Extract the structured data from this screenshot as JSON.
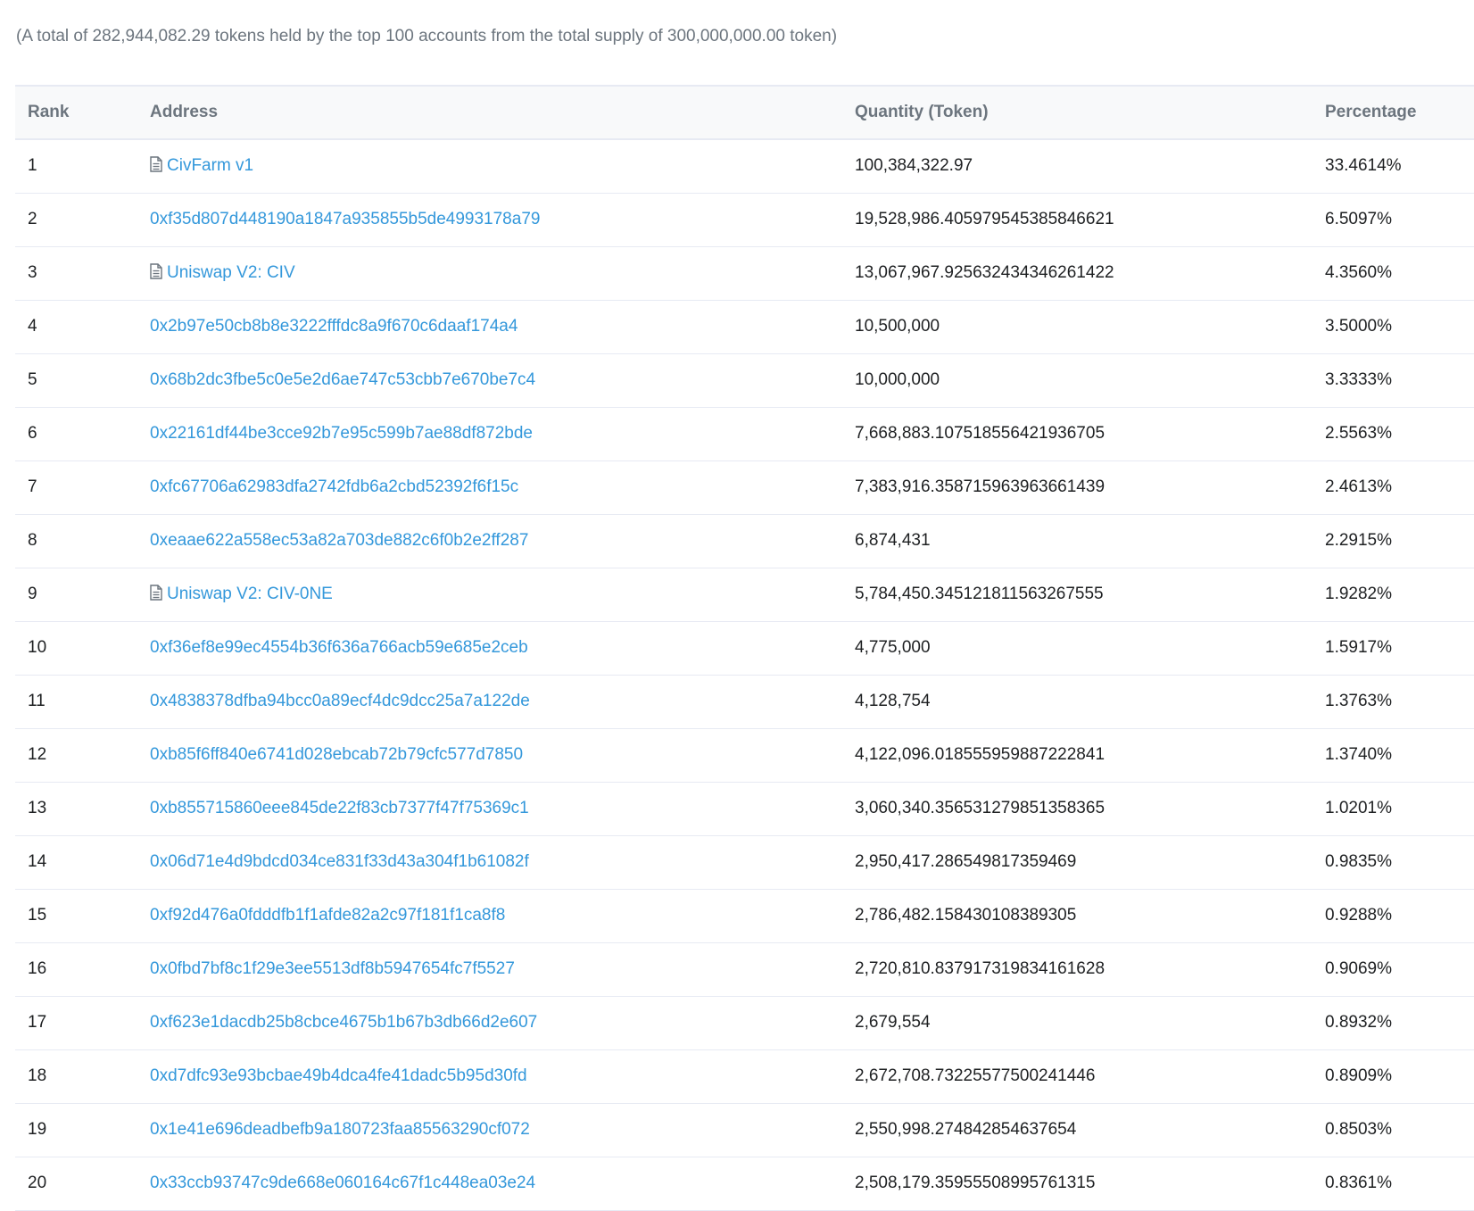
{
  "summary_text": "(A total of 282,944,082.29 tokens held by the top 100 accounts from the total supply of 300,000,000.00 token)",
  "table": {
    "headers": {
      "rank": "Rank",
      "address": "Address",
      "quantity": "Quantity (Token)",
      "percentage": "Percentage"
    },
    "rows": [
      {
        "rank": "1",
        "address": "CivFarm v1",
        "is_contract": true,
        "quantity": "100,384,322.97",
        "percentage": "33.4614%"
      },
      {
        "rank": "2",
        "address": "0xf35d807d448190a1847a935855b5de4993178a79",
        "is_contract": false,
        "quantity": "19,528,986.405979545385846621",
        "percentage": "6.5097%"
      },
      {
        "rank": "3",
        "address": "Uniswap V2: CIV",
        "is_contract": true,
        "quantity": "13,067,967.925632434346261422",
        "percentage": "4.3560%"
      },
      {
        "rank": "4",
        "address": "0x2b97e50cb8b8e3222fffdc8a9f670c6daaf174a4",
        "is_contract": false,
        "quantity": "10,500,000",
        "percentage": "3.5000%"
      },
      {
        "rank": "5",
        "address": "0x68b2dc3fbe5c0e5e2d6ae747c53cbb7e670be7c4",
        "is_contract": false,
        "quantity": "10,000,000",
        "percentage": "3.3333%"
      },
      {
        "rank": "6",
        "address": "0x22161df44be3cce92b7e95c599b7ae88df872bde",
        "is_contract": false,
        "quantity": "7,668,883.107518556421936705",
        "percentage": "2.5563%"
      },
      {
        "rank": "7",
        "address": "0xfc67706a62983dfa2742fdb6a2cbd52392f6f15c",
        "is_contract": false,
        "quantity": "7,383,916.358715963963661439",
        "percentage": "2.4613%"
      },
      {
        "rank": "8",
        "address": "0xeaae622a558ec53a82a703de882c6f0b2e2ff287",
        "is_contract": false,
        "quantity": "6,874,431",
        "percentage": "2.2915%"
      },
      {
        "rank": "9",
        "address": "Uniswap V2: CIV-0NE",
        "is_contract": true,
        "quantity": "5,784,450.345121811563267555",
        "percentage": "1.9282%"
      },
      {
        "rank": "10",
        "address": "0xf36ef8e99ec4554b36f636a766acb59e685e2ceb",
        "is_contract": false,
        "quantity": "4,775,000",
        "percentage": "1.5917%"
      },
      {
        "rank": "11",
        "address": "0x4838378dfba94bcc0a89ecf4dc9dcc25a7a122de",
        "is_contract": false,
        "quantity": "4,128,754",
        "percentage": "1.3763%"
      },
      {
        "rank": "12",
        "address": "0xb85f6ff840e6741d028ebcab72b79cfc577d7850",
        "is_contract": false,
        "quantity": "4,122,096.018555959887222841",
        "percentage": "1.3740%"
      },
      {
        "rank": "13",
        "address": "0xb855715860eee845de22f83cb7377f47f75369c1",
        "is_contract": false,
        "quantity": "3,060,340.356531279851358365",
        "percentage": "1.0201%"
      },
      {
        "rank": "14",
        "address": "0x06d71e4d9bdcd034ce831f33d43a304f1b61082f",
        "is_contract": false,
        "quantity": "2,950,417.286549817359469",
        "percentage": "0.9835%"
      },
      {
        "rank": "15",
        "address": "0xf92d476a0fdddfb1f1afde82a2c97f181f1ca8f8",
        "is_contract": false,
        "quantity": "2,786,482.158430108389305",
        "percentage": "0.9288%"
      },
      {
        "rank": "16",
        "address": "0x0fbd7bf8c1f29e3ee5513df8b5947654fc7f5527",
        "is_contract": false,
        "quantity": "2,720,810.837917319834161628",
        "percentage": "0.9069%"
      },
      {
        "rank": "17",
        "address": "0xf623e1dacdb25b8cbce4675b1b67b3db66d2e607",
        "is_contract": false,
        "quantity": "2,679,554",
        "percentage": "0.8932%"
      },
      {
        "rank": "18",
        "address": "0xd7dfc93e93bcbae49b4dca4fe41dadc5b95d30fd",
        "is_contract": false,
        "quantity": "2,672,708.73225577500241446",
        "percentage": "0.8909%"
      },
      {
        "rank": "19",
        "address": "0x1e41e696deadbefb9a180723faa85563290cf072",
        "is_contract": false,
        "quantity": "2,550,998.274842854637654",
        "percentage": "0.8503%"
      },
      {
        "rank": "20",
        "address": "0x33ccb93747c9de668e060164c67f1c448ea03e24",
        "is_contract": false,
        "quantity": "2,508,179.35955508995761315",
        "percentage": "0.8361%"
      }
    ]
  },
  "colors": {
    "link": "#3498db",
    "header_bg": "#f8f9fa",
    "border": "#e7eaf3",
    "muted_text": "#6c757e"
  },
  "icons": {
    "contract": "file-text-icon"
  }
}
